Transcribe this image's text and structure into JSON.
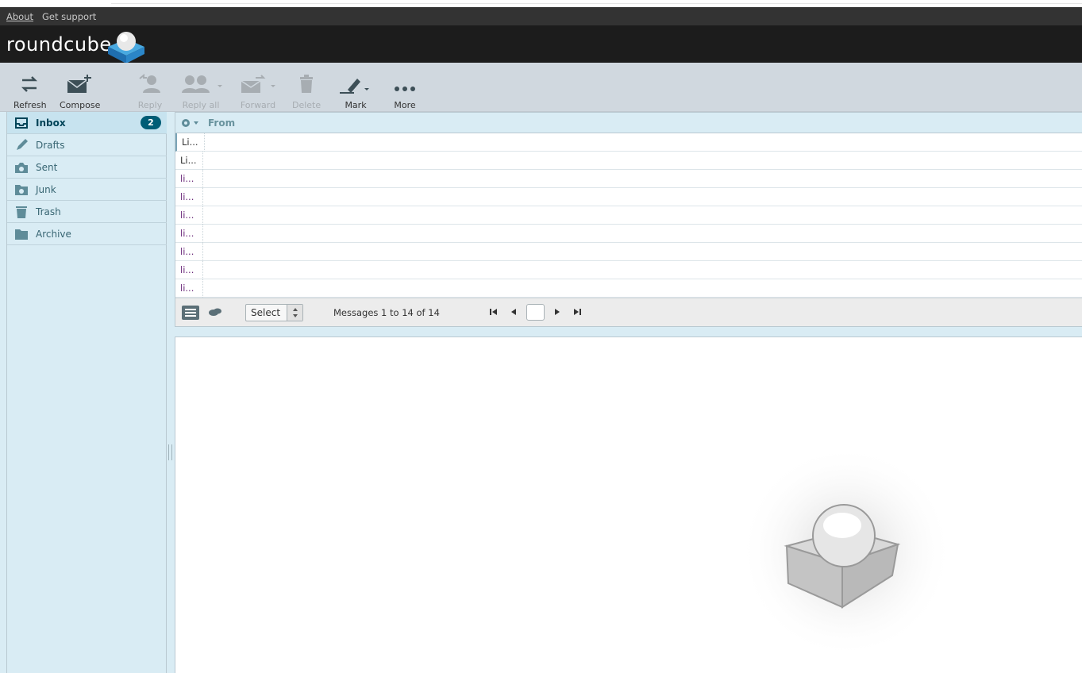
{
  "topnav": {
    "about": "About",
    "support": "Get support"
  },
  "header": {
    "logo_text": "roundcube"
  },
  "toolbar": {
    "refresh": "Refresh",
    "compose": "Compose",
    "reply": "Reply",
    "reply_all": "Reply all",
    "forward": "Forward",
    "delete": "Delete",
    "mark": "Mark",
    "more": "More"
  },
  "folders": [
    {
      "name": "Inbox",
      "icon": "inbox-icon",
      "unread": "2",
      "selected": true
    },
    {
      "name": "Drafts",
      "icon": "pencil-icon"
    },
    {
      "name": "Sent",
      "icon": "sent-icon"
    },
    {
      "name": "Junk",
      "icon": "junk-icon"
    },
    {
      "name": "Trash",
      "icon": "trash-icon"
    },
    {
      "name": "Archive",
      "icon": "archive-icon"
    }
  ],
  "messagelist": {
    "column_from": "From",
    "rows": [
      "Li...",
      "Li...",
      "li...",
      "li...",
      "li...",
      "li...",
      "li...",
      "li...",
      "li..."
    ]
  },
  "footer": {
    "select_label": "Select",
    "count": "Messages 1 to 14 of 14",
    "page": ""
  },
  "colors": {
    "accent": "#005d76",
    "sidebar": "#d9ecf4",
    "header": "#1c1c1c"
  }
}
